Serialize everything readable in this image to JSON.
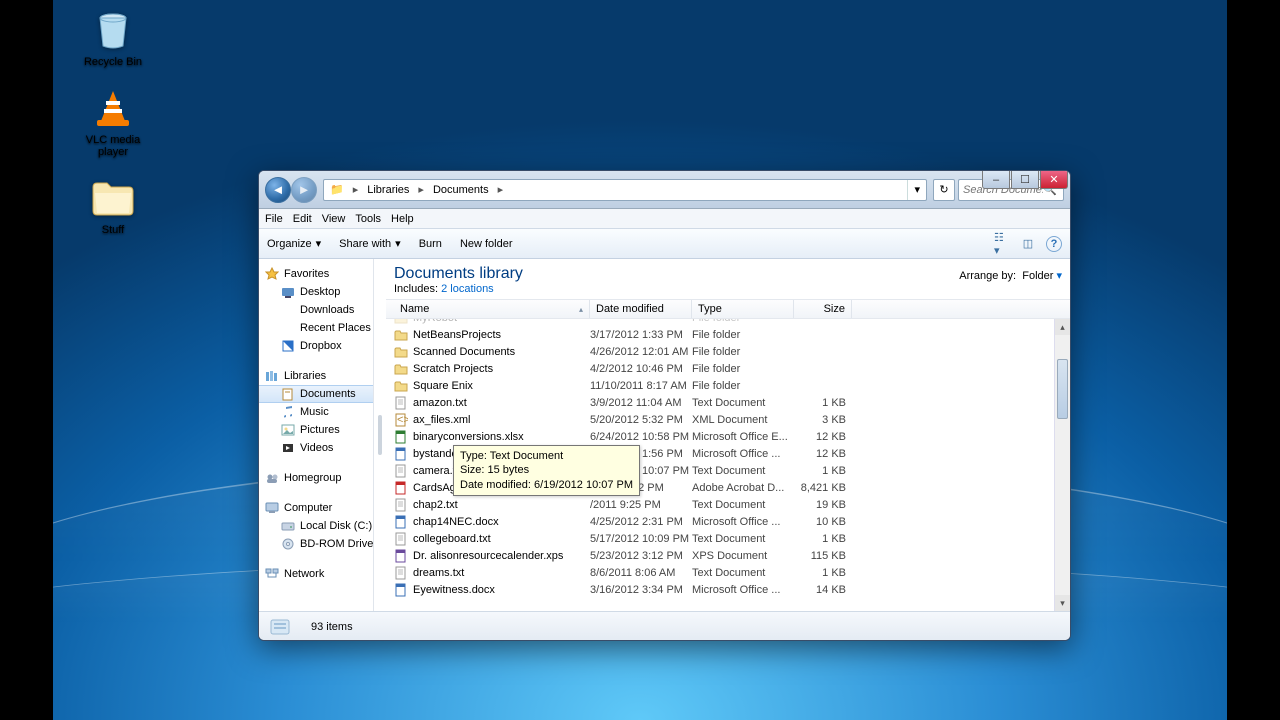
{
  "desktop_icons": [
    {
      "key": "recycle",
      "label": "Recycle Bin"
    },
    {
      "key": "vlc",
      "label": "VLC media player"
    },
    {
      "key": "stuff",
      "label": "Stuff"
    }
  ],
  "window": {
    "controls": {
      "min": "–",
      "max": "☐",
      "close": "✕"
    },
    "breadcrumb": [
      "Libraries",
      "Documents"
    ],
    "search_placeholder": "Search Docume...",
    "menu": [
      "File",
      "Edit",
      "View",
      "Tools",
      "Help"
    ],
    "toolbar": {
      "organize": "Organize",
      "share": "Share with",
      "burn": "Burn",
      "newfolder": "New folder"
    },
    "tool_icons": {
      "view": "view",
      "pane": "pane",
      "help": "help"
    }
  },
  "sidebar": {
    "favorites": {
      "label": "Favorites",
      "items": [
        "Desktop",
        "Downloads",
        "Recent Places",
        "Dropbox"
      ]
    },
    "libraries": {
      "label": "Libraries",
      "items": [
        "Documents",
        "Music",
        "Pictures",
        "Videos"
      ],
      "selected": 0
    },
    "homegroup": {
      "label": "Homegroup"
    },
    "computer": {
      "label": "Computer",
      "items": [
        "Local Disk (C:)",
        "BD-ROM Drive (E"
      ]
    },
    "network": {
      "label": "Network"
    }
  },
  "library": {
    "title": "Documents library",
    "includes": "Includes:",
    "locations": "2 locations",
    "arrange_label": "Arrange by:",
    "arrange_value": "Folder"
  },
  "columns": {
    "name": "Name",
    "date": "Date modified",
    "type": "Type",
    "size": "Size"
  },
  "files": [
    {
      "ico": "folder",
      "name": "MyRobot",
      "date": "",
      "type": "File folder",
      "size": ""
    },
    {
      "ico": "folder",
      "name": "NetBeansProjects",
      "date": "3/17/2012 1:33 PM",
      "type": "File folder",
      "size": ""
    },
    {
      "ico": "folder",
      "name": "Scanned Documents",
      "date": "4/26/2012 12:01 AM",
      "type": "File folder",
      "size": ""
    },
    {
      "ico": "folder",
      "name": "Scratch Projects",
      "date": "4/2/2012 10:46 PM",
      "type": "File folder",
      "size": ""
    },
    {
      "ico": "folder",
      "name": "Square Enix",
      "date": "11/10/2011 8:17 AM",
      "type": "File folder",
      "size": ""
    },
    {
      "ico": "txt",
      "name": "amazon.txt",
      "date": "3/9/2012 11:04 AM",
      "type": "Text Document",
      "size": "1 KB"
    },
    {
      "ico": "xml",
      "name": "ax_files.xml",
      "date": "5/20/2012 5:32 PM",
      "type": "XML Document",
      "size": "3 KB"
    },
    {
      "ico": "xls",
      "name": "binaryconversions.xlsx",
      "date": "6/24/2012 10:58 PM",
      "type": "Microsoft Office E...",
      "size": "12 KB"
    },
    {
      "ico": "doc",
      "name": "bystanderapathy.docx",
      "date": "4/25/2012 1:56 PM",
      "type": "Microsoft Office ...",
      "size": "12 KB"
    },
    {
      "ico": "txt",
      "name": "camera.txt",
      "date": "6/19/2012 10:07 PM",
      "type": "Text Document",
      "size": "1 KB"
    },
    {
      "ico": "pdf",
      "name": "CardsAgain",
      "date": "2012 11:02 PM",
      "type": "Adobe Acrobat D...",
      "size": "8,421 KB"
    },
    {
      "ico": "txt",
      "name": "chap2.txt",
      "date": "/2011 9:25 PM",
      "type": "Text Document",
      "size": "19 KB"
    },
    {
      "ico": "doc",
      "name": "chap14NEC.docx",
      "date": "4/25/2012 2:31 PM",
      "type": "Microsoft Office ...",
      "size": "10 KB"
    },
    {
      "ico": "txt",
      "name": "collegeboard.txt",
      "date": "5/17/2012 10:09 PM",
      "type": "Text Document",
      "size": "1 KB"
    },
    {
      "ico": "xps",
      "name": "Dr. alisonresourcecalender.xps",
      "date": "5/23/2012 3:12 PM",
      "type": "XPS Document",
      "size": "115 KB"
    },
    {
      "ico": "txt",
      "name": "dreams.txt",
      "date": "8/6/2011 8:06 AM",
      "type": "Text Document",
      "size": "1 KB"
    },
    {
      "ico": "doc",
      "name": "Eyewitness.docx",
      "date": "3/16/2012 3:34 PM",
      "type": "Microsoft Office ...",
      "size": "14 KB"
    }
  ],
  "tooltip": {
    "line1": "Type: Text Document",
    "line2": "Size: 15 bytes",
    "line3": "Date modified: 6/19/2012 10:07 PM"
  },
  "status": {
    "items": "93 items"
  }
}
